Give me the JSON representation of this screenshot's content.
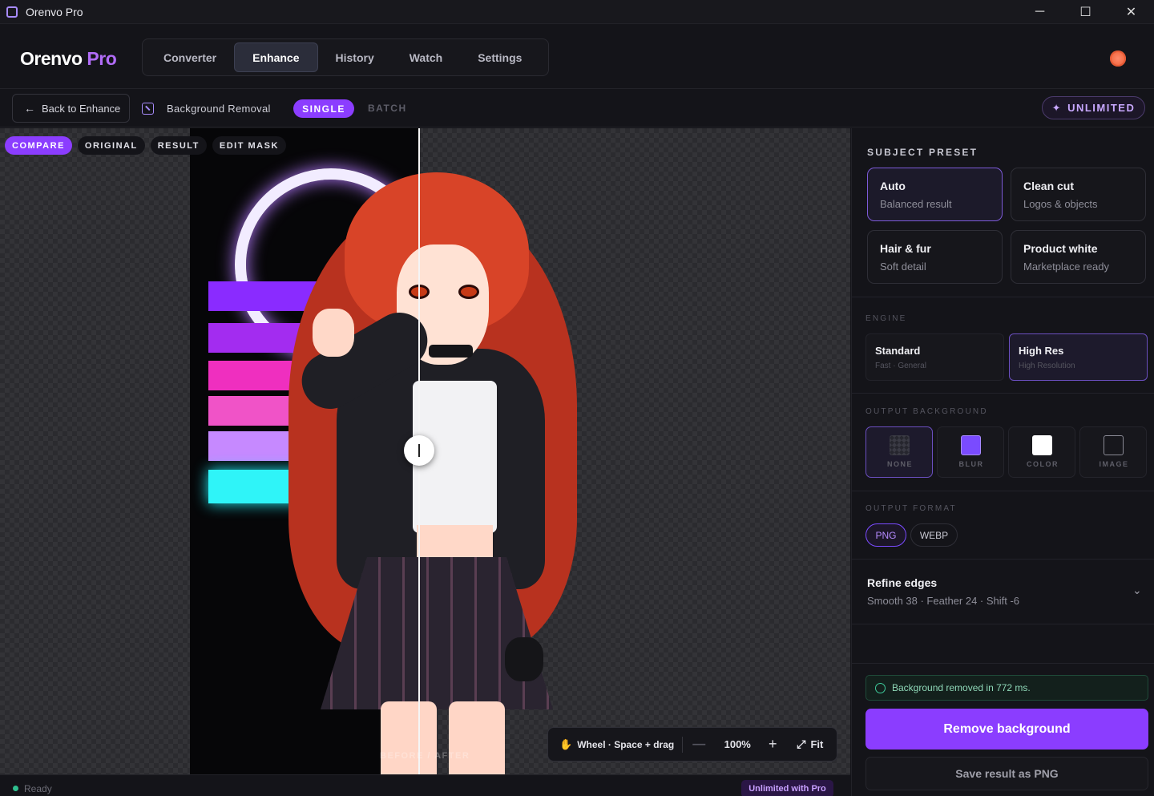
{
  "window": {
    "title": "Orenvo Pro",
    "controls": [
      "─",
      "☐",
      "✕"
    ]
  },
  "header": {
    "brand_main": "Orenvo",
    "brand_accent": "Pro",
    "tabs": [
      {
        "label": "Converter"
      },
      {
        "label": "Enhance",
        "active": true
      },
      {
        "label": "History"
      },
      {
        "label": "Watch"
      },
      {
        "label": "Settings"
      }
    ]
  },
  "toolbar": {
    "back_label": "Back to Enhance",
    "tool_name": "Background Removal",
    "mode_single": "SINGLE",
    "mode_batch": "BATCH",
    "plan_badge": "UNLIMITED"
  },
  "canvas": {
    "view_tabs": [
      {
        "label": "COMPARE",
        "active": true
      },
      {
        "label": "ORIGINAL"
      },
      {
        "label": "RESULT"
      },
      {
        "label": "EDIT MASK"
      }
    ],
    "compare_label": "BEFORE / AFTER",
    "zoom": {
      "hint": "Wheel · Space + drag",
      "minus": "—",
      "level": "100%",
      "plus": "+",
      "fit_label": "Fit"
    }
  },
  "status": {
    "text": "Ready",
    "pro_label": "Unlimited with Pro"
  },
  "panel": {
    "subject_preset_title": "SUBJECT PRESET",
    "presets": [
      {
        "title": "Auto",
        "subtitle": "Balanced result",
        "active": true
      },
      {
        "title": "Clean cut",
        "subtitle": "Logos & objects"
      },
      {
        "title": "Hair & fur",
        "subtitle": "Soft detail"
      },
      {
        "title": "Product white",
        "subtitle": "Marketplace ready"
      }
    ],
    "engine_title": "ENGINE",
    "engines": [
      {
        "title": "Standard",
        "subtitle": "Fast · General"
      },
      {
        "title": "High Res",
        "subtitle": "High Resolution",
        "active": true
      }
    ],
    "output_bg_title": "OUTPUT BACKGROUND",
    "bg_options": [
      {
        "label": "NONE",
        "active": true
      },
      {
        "label": "BLUR"
      },
      {
        "label": "COLOR"
      },
      {
        "label": "IMAGE"
      }
    ],
    "output_format_title": "OUTPUT FORMAT",
    "formats": [
      {
        "label": "PNG",
        "active": true
      },
      {
        "label": "WEBP"
      }
    ],
    "refine_title": "Refine edges",
    "refine_summary": "Smooth 38 · Feather 24 · Shift -6",
    "toast": "Background removed in 772 ms.",
    "primary_button": "Remove background",
    "secondary_button": "Save result as PNG"
  },
  "colors": {
    "accent": "#8b3dff",
    "success": "#3ec99a",
    "user_avatar": "#f2673f"
  }
}
